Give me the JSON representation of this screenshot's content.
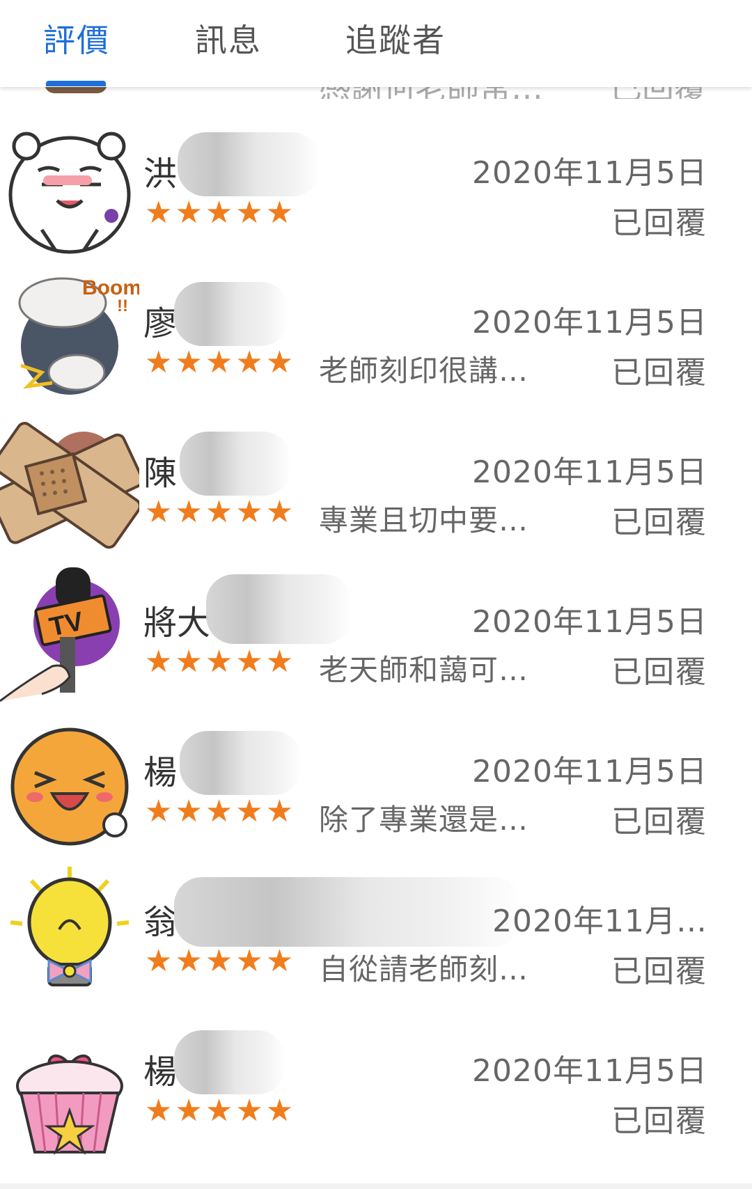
{
  "tabs": [
    {
      "label": "評價",
      "active": true
    },
    {
      "label": "訊息",
      "active": false
    },
    {
      "label": "追蹤者",
      "active": false
    }
  ],
  "colors": {
    "accent": "#1e6fd9",
    "star": "#f07c1c",
    "text": "#333333",
    "muted": "#666666"
  },
  "partial_row": {
    "snippet": "感謝何老師常…",
    "status": "已回覆"
  },
  "reviews": [
    {
      "name": "洪",
      "date": "2020年11月5日",
      "stars": "★★★★★",
      "rating": 5,
      "snippet": "",
      "status": "已回覆",
      "avatar": "bear-sticker"
    },
    {
      "name": "廖",
      "date": "2020年11月5日",
      "stars": "★★★★★",
      "rating": 5,
      "snippet": "老師刻印很講…",
      "status": "已回覆",
      "avatar": "boom-sticker"
    },
    {
      "name": "陳",
      "date": "2020年11月5日",
      "stars": "★★★★★",
      "rating": 5,
      "snippet": "專業且切中要…",
      "status": "已回覆",
      "avatar": "bandage-sticker"
    },
    {
      "name": "將大",
      "date": "2020年11月5日",
      "stars": "★★★★★",
      "rating": 5,
      "snippet": "老天師和藹可…",
      "status": "已回覆",
      "avatar": "tv-mic-sticker"
    },
    {
      "name": "楊",
      "date": "2020年11月5日",
      "stars": "★★★★★",
      "rating": 5,
      "snippet": "除了專業還是…",
      "status": "已回覆",
      "avatar": "smiley-sticker"
    },
    {
      "name": "翁",
      "date": "2020年11月…",
      "stars": "★★★★★",
      "rating": 5,
      "snippet": "自從請老師刻…",
      "status": "已回覆",
      "avatar": "lightbulb-sticker"
    },
    {
      "name": "楊",
      "date": "2020年11月5日",
      "stars": "★★★★★",
      "rating": 5,
      "snippet": "",
      "status": "已回覆",
      "avatar": "cupcake-sticker"
    }
  ]
}
